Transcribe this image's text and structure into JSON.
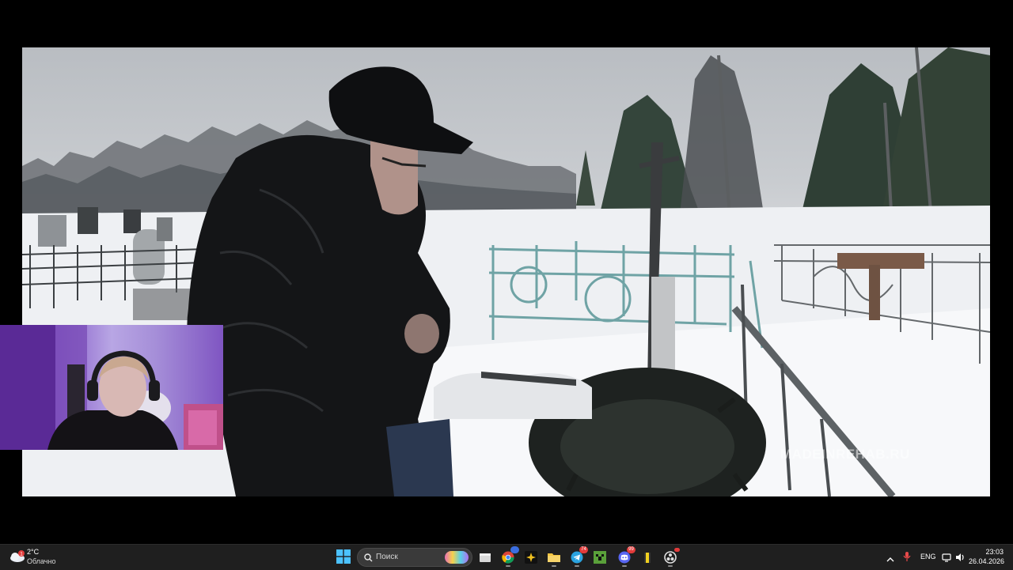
{
  "video": {
    "watermark": "MADEINREHAB.RU"
  },
  "webcam": {
    "label": ""
  },
  "taskbar": {
    "weather": {
      "temperature": "2°C",
      "description": "Облачно",
      "alert_count": "1",
      "icon": "cloud-icon"
    },
    "search": {
      "placeholder": "Поиск"
    },
    "apps": [
      {
        "name": "file-explorer-icon",
        "color": "#e8e8e8"
      },
      {
        "name": "chrome-icon",
        "color": "#4285f4",
        "badge": ""
      },
      {
        "name": "pinned-app-icon",
        "color": "#f0c020"
      },
      {
        "name": "folder-icon",
        "color": "#f5c542"
      },
      {
        "name": "telegram-icon",
        "color": "#2aa3e0",
        "badge": "74"
      },
      {
        "name": "minecraft-icon",
        "color": "#5aa03a"
      },
      {
        "name": "discord-icon",
        "color": "#5865f2",
        "badge": "99"
      },
      {
        "name": "battery-app-icon",
        "color": "#f0d020"
      },
      {
        "name": "obs-icon",
        "color": "#e0e0e0"
      }
    ],
    "tray": {
      "language": "ENG",
      "time": "23:03",
      "date": "26.04.2026"
    }
  }
}
